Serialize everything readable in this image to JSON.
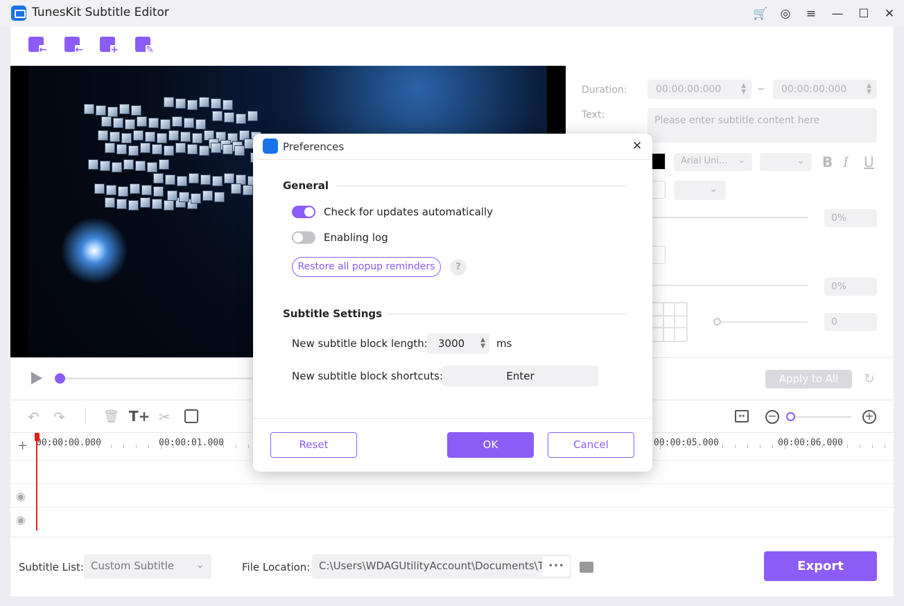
{
  "window": {
    "title": "TunesKit Subtitle Editor"
  },
  "editor": {
    "duration_label": "Duration:",
    "start_time": "00:00:00:000",
    "time_sep": "~",
    "end_time": "00:00:00:000",
    "text_label": "Text:",
    "text_placeholder": "Please enter subtitle content here",
    "font": "Arial Uni...",
    "style_b": "B",
    "style_i": "I",
    "style_u": "U",
    "opacity1": "0%",
    "opacity2": "0%",
    "spacing": "0",
    "apply_all": "Apply to All"
  },
  "timeline": {
    "times": [
      "00:00:00.000",
      "00:00:01.000",
      "00:00:05.000",
      "00:00:06.000"
    ],
    "add": "+"
  },
  "bottom": {
    "subtitle_list_label": "Subtitle List:",
    "subtitle_list_value": "Custom Subtitle",
    "file_location_label": "File Location:",
    "file_location_value": "C:\\Users\\WDAGUtilityAccount\\Documents\\T",
    "more": "•••",
    "export": "Export"
  },
  "dialog": {
    "title": "Preferences",
    "close": "✕",
    "general": "General",
    "auto_update": {
      "label": "Check for updates automatically",
      "on": true
    },
    "enable_log": {
      "label": "Enabling log",
      "on": false
    },
    "restore": "Restore all popup reminders",
    "help": "?",
    "subtitle_settings": "Subtitle Settings",
    "block_length_label": "New subtitle block length:",
    "block_length_value": "3000",
    "block_length_unit": "ms",
    "shortcut_label": "New subtitle block shortcuts:",
    "shortcut_value": "Enter",
    "reset": "Reset",
    "ok": "OK",
    "cancel": "Cancel"
  },
  "colors": {
    "accent": "#8b5cf6",
    "record_head": "#e02020"
  }
}
